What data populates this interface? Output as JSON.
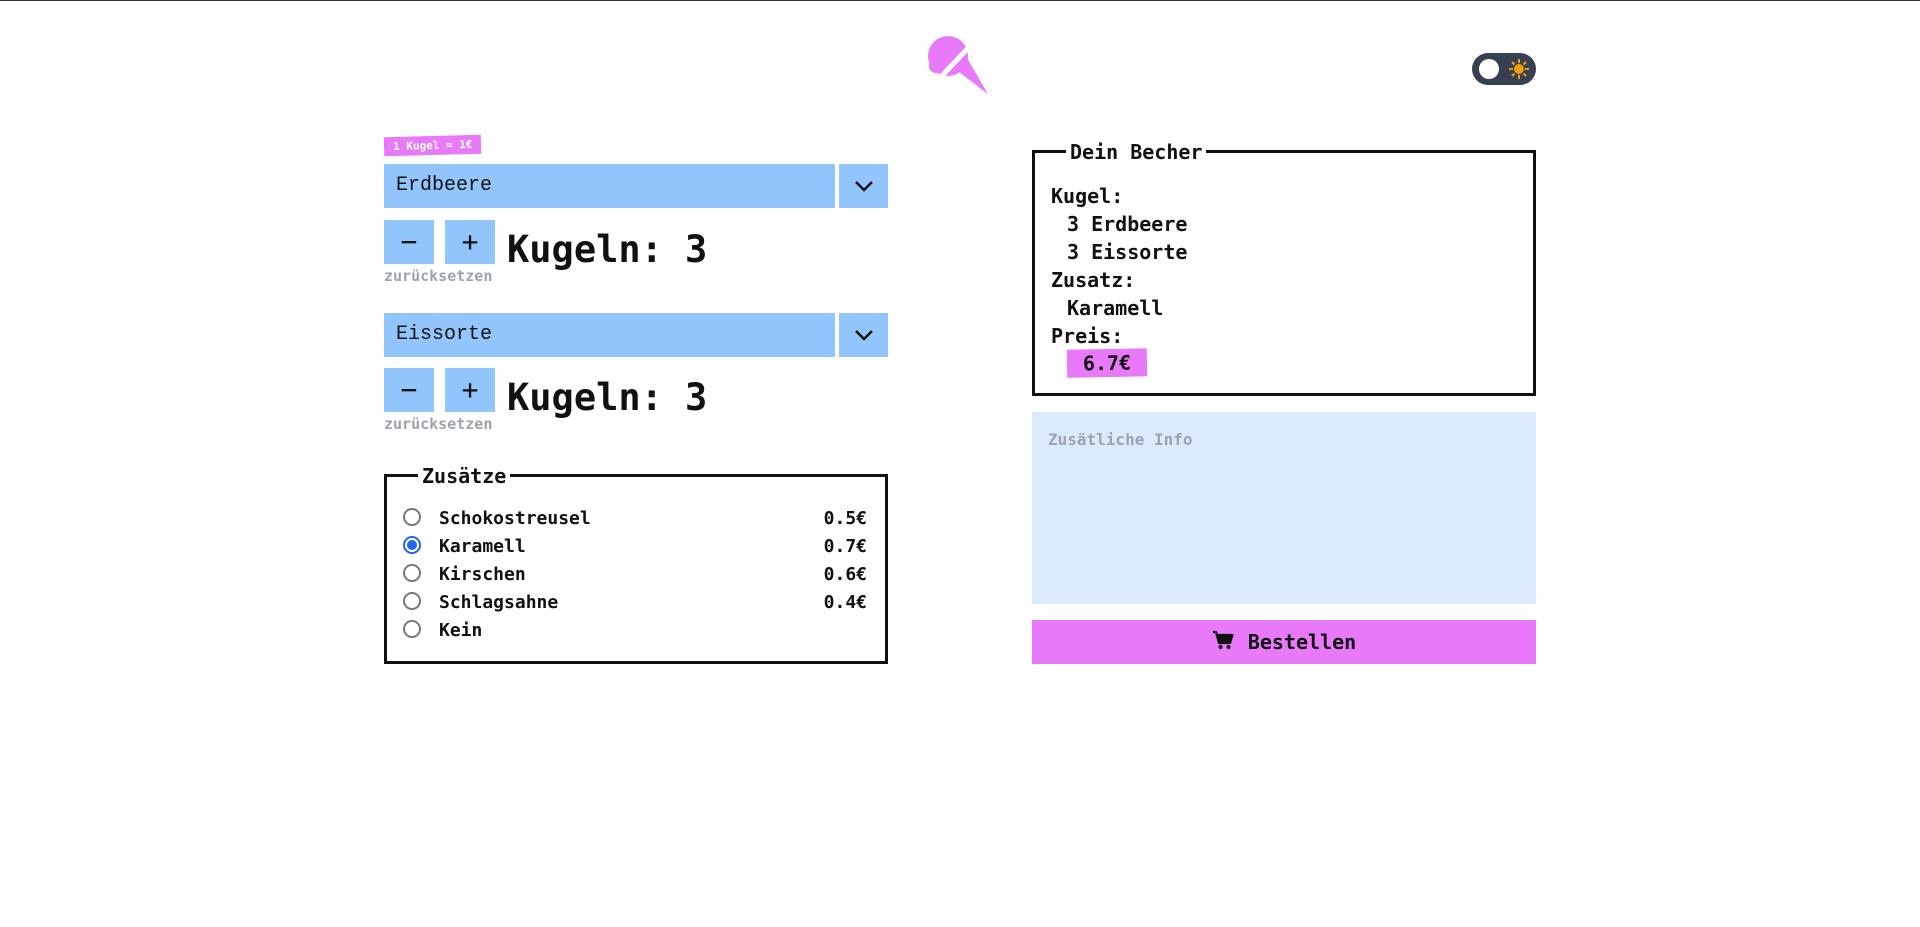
{
  "header": {
    "logo_icon": "ice-cream-cone-icon",
    "theme_toggle_icon": "sun-icon"
  },
  "flavor_picker": {
    "price_note": "1 Kugel = 1€",
    "entries": [
      {
        "flavor": "Erdbeere",
        "decrement_label": "−",
        "increment_label": "+",
        "count_label": "Kugeln:",
        "count": "3",
        "reset_label": "zurücksetzen"
      },
      {
        "flavor": "Eissorte",
        "decrement_label": "−",
        "increment_label": "+",
        "count_label": "Kugeln:",
        "count": "3",
        "reset_label": "zurücksetzen"
      }
    ]
  },
  "addons": {
    "legend": "Zusätze",
    "options": [
      {
        "name": "Schokostreusel",
        "price": "0.5€",
        "checked": false
      },
      {
        "name": "Karamell",
        "price": "0.7€",
        "checked": true
      },
      {
        "name": "Kirschen",
        "price": "0.6€",
        "checked": false
      },
      {
        "name": "Schlagsahne",
        "price": "0.4€",
        "checked": false
      },
      {
        "name": "Kein",
        "price": "",
        "checked": false
      }
    ]
  },
  "summary": {
    "legend": "Dein Becher",
    "scoops_heading": "Kugel:",
    "scoops": [
      "3 Erdbeere",
      "3 Eissorte"
    ],
    "addon_heading": "Zusatz:",
    "addon": "Karamell",
    "price_heading": "Preis:",
    "price": "6.7€"
  },
  "extra_info": {
    "placeholder": "Zusätliche Info"
  },
  "order_button": {
    "label": "Bestellen",
    "icon": "shopping-cart-icon"
  },
  "colors": {
    "accent_pink": "#e879f9",
    "control_blue": "#93c5fd",
    "textarea_blue": "#dbeafe",
    "toggle_dark": "#374151"
  }
}
